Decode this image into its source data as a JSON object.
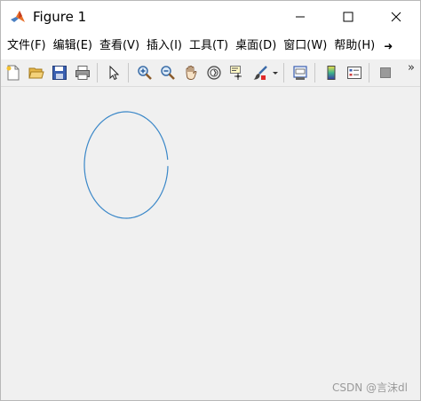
{
  "window": {
    "title": "Figure 1"
  },
  "menu": {
    "items": [
      "文件(F)",
      "编辑(E)",
      "查看(V)",
      "插入(I)",
      "工具(T)",
      "桌面(D)",
      "窗口(W)",
      "帮助(H)"
    ],
    "more": "➜"
  },
  "toolbar": {
    "buttons": [
      {
        "name": "new-figure-icon"
      },
      {
        "name": "open-file-icon"
      },
      {
        "name": "save-icon"
      },
      {
        "name": "print-icon"
      },
      {
        "name": "pointer-icon"
      },
      {
        "name": "zoom-in-icon"
      },
      {
        "name": "zoom-out-icon"
      },
      {
        "name": "pan-hand-icon"
      },
      {
        "name": "rotate-3d-icon"
      },
      {
        "name": "data-cursor-icon"
      },
      {
        "name": "brush-icon"
      },
      {
        "name": "link-plot-icon"
      },
      {
        "name": "insert-colorbar-icon"
      },
      {
        "name": "insert-legend-icon"
      },
      {
        "name": "hide-plot-tools-icon"
      }
    ],
    "overflow": "»"
  },
  "plot": {
    "shape": "open ellipse arc",
    "stroke_color": "#3a87c8"
  },
  "colors": {
    "background": "#f0f0f0",
    "titlebar": "#ffffff",
    "plot_line": "#3a87c8"
  },
  "watermark": "CSDN @言沫dl"
}
